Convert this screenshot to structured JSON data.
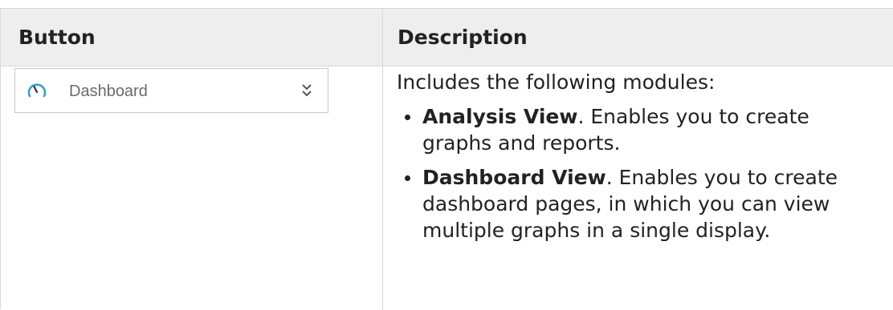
{
  "table": {
    "headers": {
      "button": "Button",
      "description": "Description"
    },
    "rows": [
      {
        "button": {
          "label": "Dashboard",
          "icon": "gauge-icon",
          "chevron_icon": "double-chevron-down-icon",
          "colors": {
            "icon": "#3aa0c8",
            "label": "#6b6b6b"
          }
        },
        "description": {
          "intro": "Includes the following modules:",
          "items": [
            {
              "term": "Analysis View",
              "text": ". Enables you to create graphs and reports."
            },
            {
              "term": "Dashboard View",
              "text": ". Enables you to create dashboard pages, in which you can view multiple graphs in a single display."
            }
          ]
        }
      }
    ]
  }
}
